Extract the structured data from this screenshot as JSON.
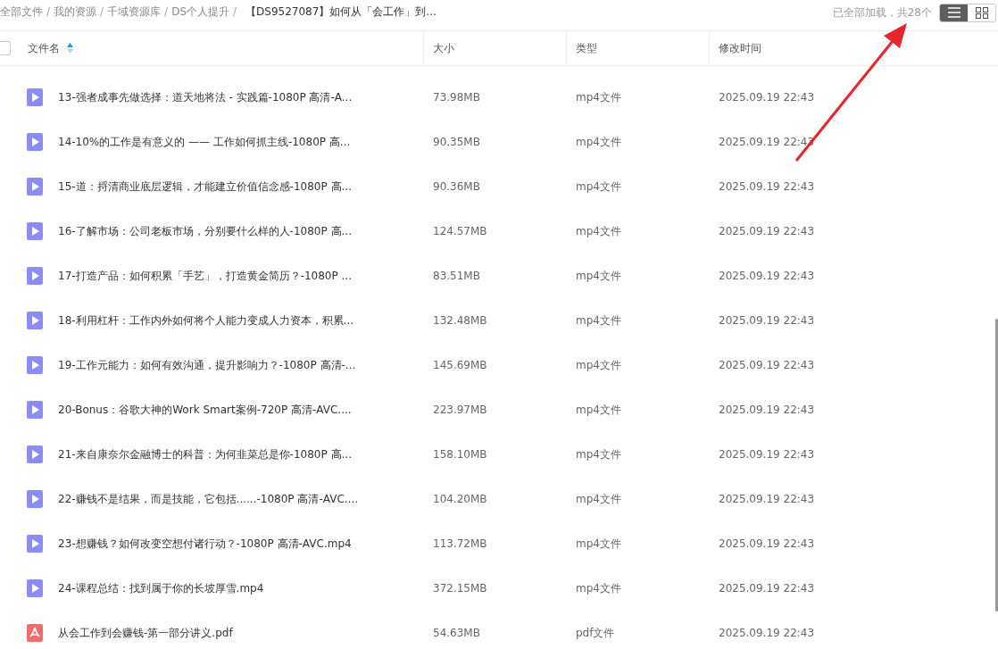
{
  "breadcrumb": [
    {
      "label": "全部文件",
      "separator": "/",
      "current": false
    },
    {
      "label": "我的资源",
      "separator": "/",
      "current": false
    },
    {
      "label": "千域资源库",
      "separator": "/",
      "current": false
    },
    {
      "label": "DS个人提升",
      "separator": "/",
      "current": false
    },
    {
      "label": "【DS9527087】如何从「会工作」到...",
      "current": true
    }
  ],
  "load_status": "已全部加载，共28个",
  "view_toggle": [
    {
      "kind": "list",
      "selected": true
    },
    {
      "kind": "grid",
      "selected": false
    }
  ],
  "table": {
    "select_all": {
      "checked": false
    },
    "columns": [
      {
        "label": "文件名",
        "sorted_ascending": true
      },
      {
        "label": "大小"
      },
      {
        "label": "类型"
      },
      {
        "label": "修改时间"
      }
    ],
    "rows": [
      {
        "kind": "video",
        "name": "13-强者成事先做选择：道天地将法 - 实践篇-1080P 高清-A...",
        "size": "73.98MB",
        "type": "mp4文件",
        "modified": "2025.09.19 22:43"
      },
      {
        "kind": "video",
        "name": "14-10%的工作是有意义的 —— 工作如何抓主线-1080P 高...",
        "size": "90.35MB",
        "type": "mp4文件",
        "modified": "2025.09.19 22:43"
      },
      {
        "kind": "video",
        "name": "15-道：捋清商业底层逻辑，才能建立价值信念感-1080P 高...",
        "size": "90.36MB",
        "type": "mp4文件",
        "modified": "2025.09.19 22:43"
      },
      {
        "kind": "video",
        "name": "16-了解市场：公司老板市场，分别要什么样的人-1080P 高...",
        "size": "124.57MB",
        "type": "mp4文件",
        "modified": "2025.09.19 22:43"
      },
      {
        "kind": "video",
        "name": "17-打造产品：如何积累「手艺」，打造黄金简历？-1080P ...",
        "size": "83.51MB",
        "type": "mp4文件",
        "modified": "2025.09.19 22:43"
      },
      {
        "kind": "video",
        "name": "18-利用杠杆：工作内外如何将个人能力变成人力资本，积累...",
        "size": "132.48MB",
        "type": "mp4文件",
        "modified": "2025.09.19 22:43"
      },
      {
        "kind": "video",
        "name": "19-工作元能力：如何有效沟通，提升影响力？-1080P 高清-...",
        "size": "145.69MB",
        "type": "mp4文件",
        "modified": "2025.09.19 22:43"
      },
      {
        "kind": "video",
        "name": "20-Bonus：谷歌大神的Work Smart案例-720P 高清-AVC....",
        "size": "223.97MB",
        "type": "mp4文件",
        "modified": "2025.09.19 22:43"
      },
      {
        "kind": "video",
        "name": "21-来自康奈尔金融博士的科普：为何韭菜总是你-1080P 高...",
        "size": "158.10MB",
        "type": "mp4文件",
        "modified": "2025.09.19 22:43"
      },
      {
        "kind": "video",
        "name": "22-赚钱不是结果，而是技能，它包括......-1080P 高清-AVC....",
        "size": "104.20MB",
        "type": "mp4文件",
        "modified": "2025.09.19 22:43"
      },
      {
        "kind": "video",
        "name": "23-想赚钱？如何改变空想付诸行动？-1080P 高清-AVC.mp4",
        "size": "113.72MB",
        "type": "mp4文件",
        "modified": "2025.09.19 22:43"
      },
      {
        "kind": "video",
        "name": "24-课程总结：找到属于你的长坡厚雪.mp4",
        "size": "372.15MB",
        "type": "mp4文件",
        "modified": "2025.09.19 22:43"
      },
      {
        "kind": "pdf",
        "name": "从会工作到会赚钱-第一部分讲义.pdf",
        "size": "54.63MB",
        "type": "pdf文件",
        "modified": "2025.09.19 22:43"
      }
    ]
  },
  "annotation": {
    "kind": "arrow"
  }
}
